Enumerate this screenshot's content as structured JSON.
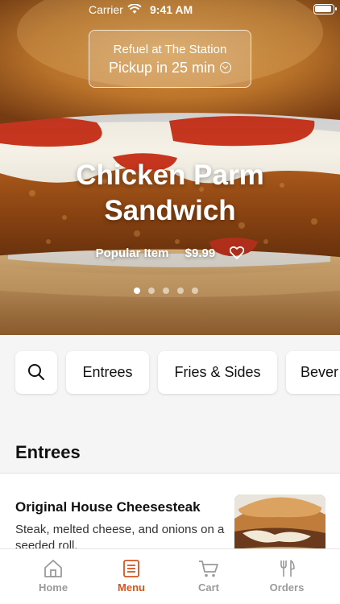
{
  "status_bar": {
    "carrier": "Carrier",
    "time": "9:41 AM"
  },
  "location": {
    "line1": "Refuel at The Station",
    "line2": "Pickup in 25 min"
  },
  "hero": {
    "title_line1": "Chicken Parm",
    "title_line2": "Sandwich",
    "tag": "Popular Item",
    "price": "$9.99",
    "slides": 5,
    "active_slide": 1
  },
  "categories": [
    "Entrees",
    "Fries & Sides",
    "Bever"
  ],
  "section": {
    "title": "Entrees",
    "items": [
      {
        "name": "Original House Cheesesteak",
        "description": "Steak, melted cheese, and onions on a seeded roll."
      }
    ]
  },
  "tabs": [
    {
      "label": "Home",
      "icon": "home-icon",
      "active": false
    },
    {
      "label": "Menu",
      "icon": "menu-icon",
      "active": true
    },
    {
      "label": "Cart",
      "icon": "cart-icon",
      "active": false
    },
    {
      "label": "Orders",
      "icon": "utensils-icon",
      "active": false
    }
  ],
  "colors": {
    "accent": "#d4541e",
    "inactive_tab": "#9a9a9a",
    "background": "#f5f5f5"
  }
}
